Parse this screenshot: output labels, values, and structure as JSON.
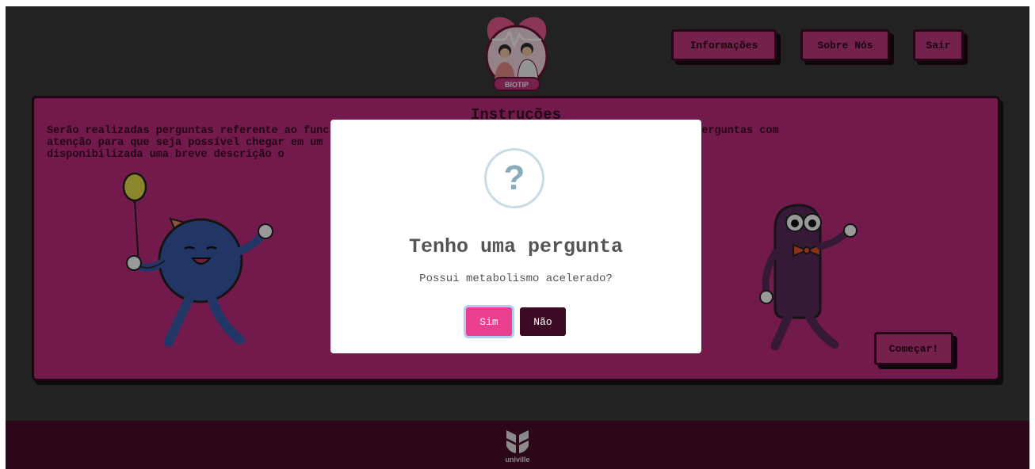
{
  "header": {
    "logo_text": "BIOTIP",
    "nav": [
      {
        "label": "Informações"
      },
      {
        "label": "Sobre Nós"
      },
      {
        "label": "Sair"
      }
    ]
  },
  "instructions": {
    "title": "Instruções",
    "lines": [
      "Serão realizadas perguntas referente ao funcionamento do seu corpo e estrutura de ossos, responda as perguntas com",
      "atenção para que seja possível chegar em um resultado mais próximo do seu biotipo. Por fim será",
      "disponibilizada uma breve descrição o                                          sultado esperado."
    ],
    "start_button": "Começar!"
  },
  "modal": {
    "icon": "question-icon",
    "icon_glyph": "?",
    "title": "Tenho uma pergunta",
    "question": "Possui metabolismo acelerado?",
    "yes_label": "Sim",
    "no_label": "Não"
  },
  "footer": {
    "logo_text": "univille"
  },
  "colors": {
    "background": "#3a3a3a",
    "card": "#c02c80",
    "footer": "#4a0a2b",
    "yes": "#ea3e91",
    "no": "#3d0a23"
  }
}
